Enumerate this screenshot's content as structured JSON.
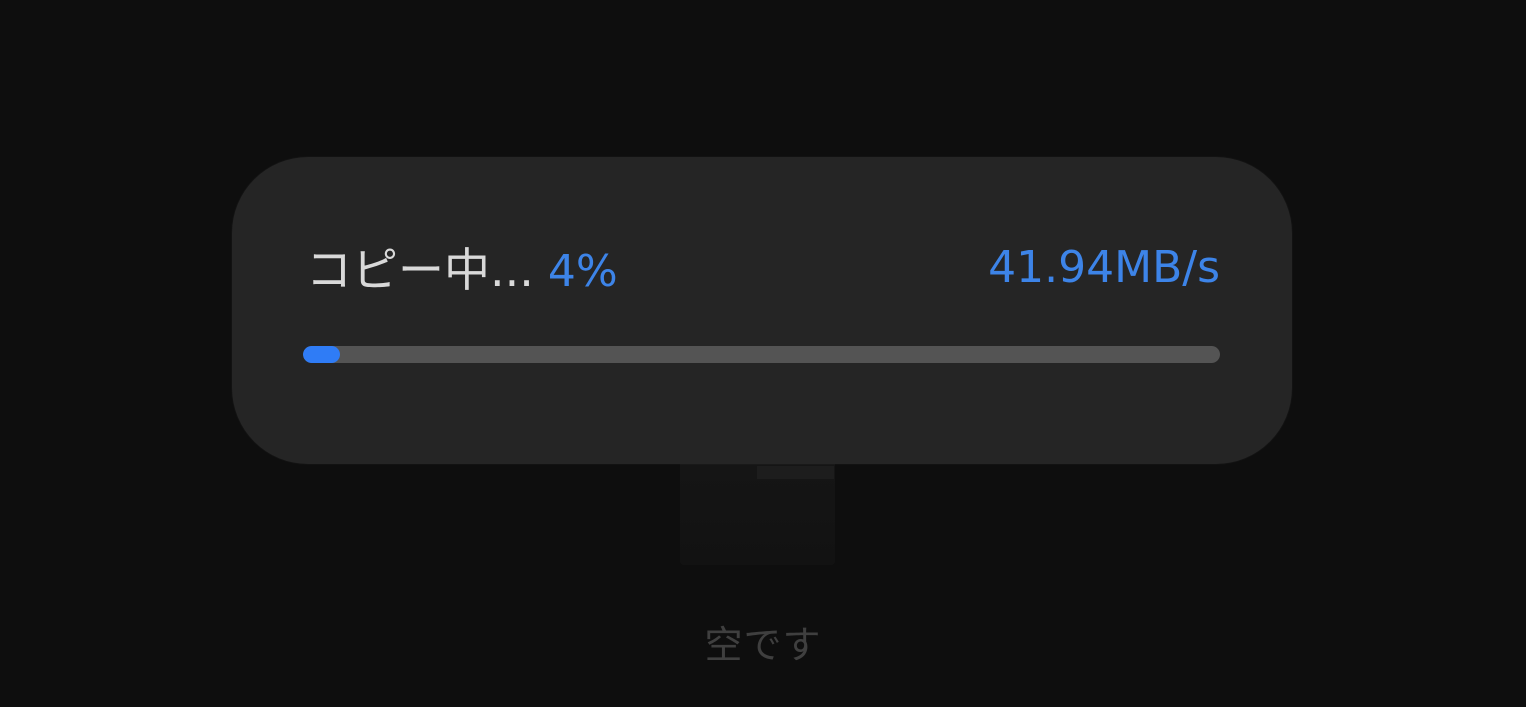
{
  "copy_dialog": {
    "status": "コピー中...",
    "percent_text": "4%",
    "progress": 0.04,
    "speed": "41.94MB/s"
  },
  "background": {
    "empty_message": "空です"
  },
  "colors": {
    "accent": "#3d84e8",
    "progress_fill": "#2f7cf6",
    "progress_track": "#545454",
    "popup_bg": "#252525",
    "page_bg": "#0e0e0e"
  }
}
